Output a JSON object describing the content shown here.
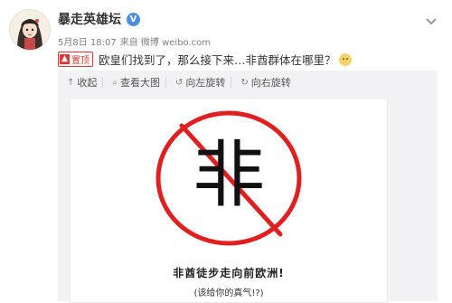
{
  "post": {
    "username": "暴走英雄坛",
    "verified_badge": "V",
    "meta": {
      "date": "5月8日 18:07",
      "source": "来自 微博 weibo.com"
    },
    "pinned_label": "置顶",
    "text": "欧皇们找到了，那么接下来…非酋群体在哪里？",
    "emoji_icon": "smile-emoji"
  },
  "toolbar": {
    "collapse": "收起",
    "view_large": "查看大图",
    "rotate_left": "向左旋转",
    "rotate_right": "向右旋转"
  },
  "image": {
    "symbol_text": "非",
    "caption_line1": "非酋徒步走向前欧洲!",
    "caption_line2": "(该给你的真气!?)",
    "accent": "#e02020"
  }
}
